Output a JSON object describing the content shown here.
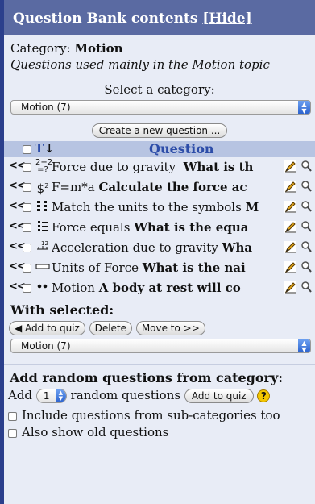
{
  "header": {
    "title": "Question Bank contents",
    "hide_link": "[Hide]"
  },
  "category": {
    "label": "Category:",
    "name": "Motion",
    "description": "Questions used mainly in the Motion topic"
  },
  "select_category": {
    "label": "Select a category:",
    "value": "Motion (7)"
  },
  "create_button": "Create a new question ...",
  "table": {
    "col_type": "T",
    "col_sort": "↓",
    "col_question": "Question",
    "rows": [
      {
        "move": "<<",
        "type_icon": "calculated-icon",
        "name": "Force due to gravity",
        "text": "What is th"
      },
      {
        "move": "<<",
        "type_icon": "formula-icon",
        "name": "F=m*a",
        "text": "Calculate the force ac"
      },
      {
        "move": "<<",
        "type_icon": "matching-icon",
        "name": "Match the units to the symbols",
        "text": "M"
      },
      {
        "move": "<<",
        "type_icon": "multichoice-icon",
        "name": "Force equals",
        "text": "What is the equa"
      },
      {
        "move": "<<",
        "type_icon": "numerical-icon",
        "name": "Acceleration due to gravity",
        "text": "Wha"
      },
      {
        "move": "<<",
        "type_icon": "shortanswer-icon",
        "name": "Units of Force",
        "text": "What is the nai"
      },
      {
        "move": "<<",
        "type_icon": "truefalse-icon",
        "name": "Motion",
        "text": "A body at rest will co"
      }
    ]
  },
  "with_selected": {
    "label": "With selected:",
    "add_to_quiz": "◀ Add to quiz",
    "delete": "Delete",
    "move_to": "Move to >>",
    "category_value": "Motion (7)"
  },
  "random": {
    "label": "Add random questions from category:",
    "add_prefix": "Add",
    "count": "1",
    "suffix": "random questions",
    "add_button": "Add to quiz",
    "help": "?"
  },
  "options": {
    "include_sub": "Include questions from sub-categories too",
    "show_old": "Also show old questions"
  }
}
